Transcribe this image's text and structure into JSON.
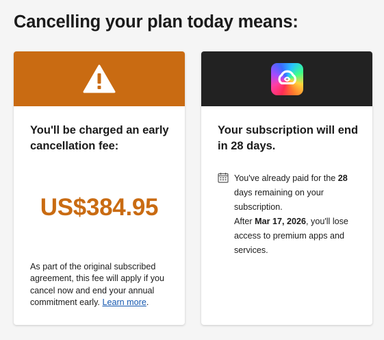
{
  "page_title": "Cancelling your plan today means:",
  "fee_card": {
    "heading": "You'll be charged an early cancellation fee:",
    "amount": "US$384.95",
    "note_text": "As part of the original subscribed agreement, this fee will apply if you cancel now and end your annual commitment early.",
    "learn_more_label": "Learn more",
    "note_end": ".",
    "header_icon": "warning-icon",
    "accent_color": "#c96b12"
  },
  "subscription_card": {
    "heading": "Your subscription will end in 28 days.",
    "info_part1": "You've already paid for the ",
    "info_bold1": "28",
    "info_part2": " days remaining on your subscription.",
    "info_part3": "After ",
    "info_bold2": "Mar 17, 2026",
    "info_part4": ", you'll lose access to premium apps and services.",
    "header_icon": "creative-cloud-icon",
    "info_icon": "calendar-icon",
    "header_color": "#222222"
  }
}
